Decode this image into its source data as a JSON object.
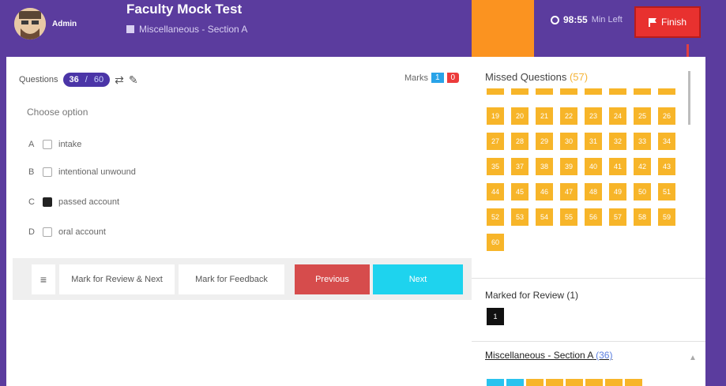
{
  "header": {
    "admin_label": "Admin",
    "test_title": "Faculty Mock Test",
    "section_label": "Miscellaneous - Section A",
    "timer_value": "98:55",
    "timer_unit": "Min Left",
    "finish_label": "Finish"
  },
  "question": {
    "label": "Questions",
    "current": "36",
    "separator": "/",
    "total": "60",
    "marks_label": "Marks",
    "marks_positive": "1",
    "marks_negative": "0",
    "text": "Choose option",
    "options": [
      {
        "letter": "A",
        "text": "intake",
        "checked": false
      },
      {
        "letter": "B",
        "text": "intentional unwound",
        "checked": false
      },
      {
        "letter": "C",
        "text": "passed account",
        "checked": true
      },
      {
        "letter": "D",
        "text": "oral account",
        "checked": false
      }
    ]
  },
  "actions": {
    "menu_icon": "≡",
    "mark_review_next": "Mark for Review & Next",
    "mark_feedback": "Mark for Feedback",
    "previous": "Previous",
    "next": "Next"
  },
  "sidebar": {
    "missed_title": "Missed Questions",
    "missed_count": "(57)",
    "missed_numbers": [
      "19",
      "20",
      "21",
      "22",
      "23",
      "24",
      "25",
      "26",
      "27",
      "28",
      "29",
      "30",
      "31",
      "32",
      "33",
      "34",
      "35",
      "37",
      "38",
      "39",
      "40",
      "41",
      "42",
      "43",
      "44",
      "45",
      "46",
      "47",
      "48",
      "49",
      "50",
      "51",
      "52",
      "53",
      "54",
      "55",
      "56",
      "57",
      "58",
      "59",
      "60"
    ],
    "review_title": "Marked for Review (1)",
    "review_numbers": [
      "1"
    ],
    "section_title": "Miscellaneous - Section A",
    "section_count": "(36)"
  },
  "colors": {
    "brand_purple": "#5b3c9e",
    "orange": "#fb9320",
    "finish_red": "#e8312f",
    "tile_yellow": "#f7b529",
    "next_cyan": "#1ed3ee",
    "prev_red": "#d64c4c"
  }
}
